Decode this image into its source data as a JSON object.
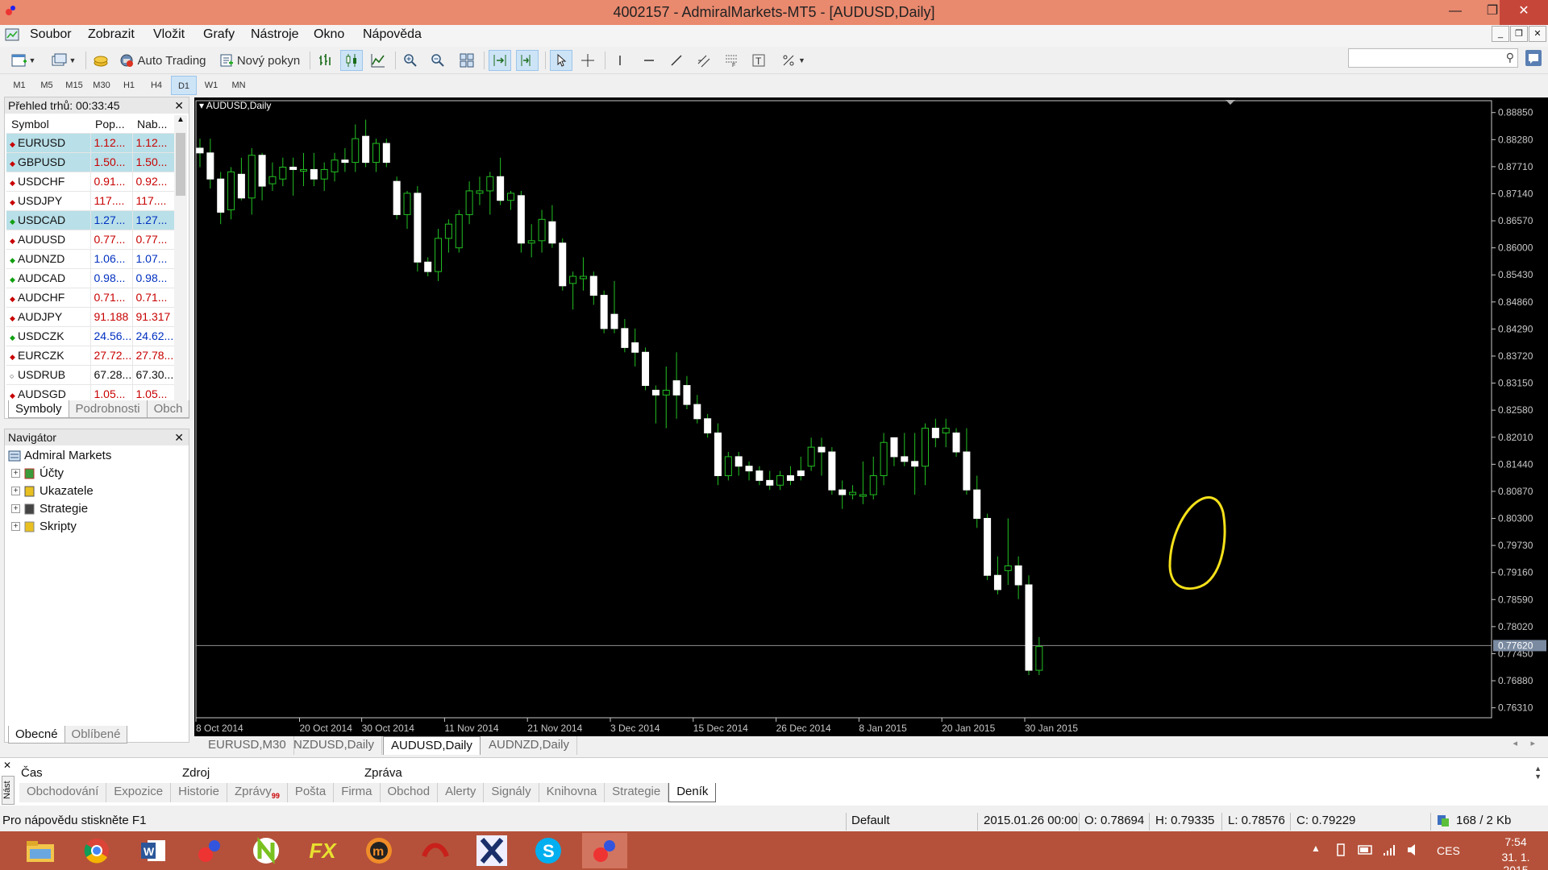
{
  "window": {
    "title": "4002157 - AdmiralMarkets-MT5 - [AUDUSD,Daily]",
    "min": "—",
    "max": "❐",
    "close": "✕"
  },
  "menu": [
    "Soubor",
    "Zobrazit",
    "Vložit",
    "Grafy",
    "Nástroje",
    "Okno",
    "Nápověda"
  ],
  "toolbar": {
    "auto_trading": "Auto Trading",
    "new_order": "Nový pokyn"
  },
  "timeframes": [
    "M1",
    "M5",
    "M15",
    "M30",
    "H1",
    "H4",
    "D1",
    "W1",
    "MN"
  ],
  "active_timeframe": "D1",
  "market_watch": {
    "title": "Přehled trhů: 00:33:45",
    "columns": [
      "Symbol",
      "Pop...",
      "Nab..."
    ],
    "rows": [
      {
        "symbol": "EURUSD",
        "bid": "1.12...",
        "ask": "1.12...",
        "dir": "down",
        "hl": true,
        "color": "red"
      },
      {
        "symbol": "GBPUSD",
        "bid": "1.50...",
        "ask": "1.50...",
        "dir": "down",
        "hl": true,
        "color": "red"
      },
      {
        "symbol": "USDCHF",
        "bid": "0.91...",
        "ask": "0.92...",
        "dir": "down",
        "hl": false,
        "color": "red"
      },
      {
        "symbol": "USDJPY",
        "bid": "117....",
        "ask": "117....",
        "dir": "down",
        "hl": false,
        "color": "red"
      },
      {
        "symbol": "USDCAD",
        "bid": "1.27...",
        "ask": "1.27...",
        "dir": "up",
        "hl": true,
        "color": "blue"
      },
      {
        "symbol": "AUDUSD",
        "bid": "0.77...",
        "ask": "0.77...",
        "dir": "down",
        "hl": false,
        "color": "red"
      },
      {
        "symbol": "AUDNZD",
        "bid": "1.06...",
        "ask": "1.07...",
        "dir": "up",
        "hl": false,
        "color": "blue"
      },
      {
        "symbol": "AUDCAD",
        "bid": "0.98...",
        "ask": "0.98...",
        "dir": "up",
        "hl": false,
        "color": "blue"
      },
      {
        "symbol": "AUDCHF",
        "bid": "0.71...",
        "ask": "0.71...",
        "dir": "down",
        "hl": false,
        "color": "red"
      },
      {
        "symbol": "AUDJPY",
        "bid": "91.188",
        "ask": "91.317",
        "dir": "down",
        "hl": false,
        "color": "red"
      },
      {
        "symbol": "USDCZK",
        "bid": "24.56...",
        "ask": "24.62...",
        "dir": "up",
        "hl": false,
        "color": "blue"
      },
      {
        "symbol": "EURCZK",
        "bid": "27.72...",
        "ask": "27.78...",
        "dir": "down",
        "hl": false,
        "color": "red"
      },
      {
        "symbol": "USDRUB",
        "bid": "67.28...",
        "ask": "67.30...",
        "dir": "none",
        "hl": false,
        "color": "black"
      },
      {
        "symbol": "AUDSGD",
        "bid": "1.05...",
        "ask": "1.05...",
        "dir": "down",
        "hl": false,
        "color": "red"
      }
    ],
    "tabs": [
      "Symboly",
      "Podrobnosti",
      "Obch"
    ]
  },
  "navigator": {
    "title": "Navigátor",
    "root": "Admiral Markets",
    "items": [
      "Účty",
      "Ukazatele",
      "Strategie",
      "Skripty"
    ],
    "tabs": [
      "Obecné",
      "Oblíbené"
    ]
  },
  "chart_data": {
    "type": "candlestick",
    "label": "AUDUSD,Daily",
    "y_ticks": [
      "0.88850",
      "0.88280",
      "0.87710",
      "0.87140",
      "0.86570",
      "0.86000",
      "0.85430",
      "0.84860",
      "0.84290",
      "0.83720",
      "0.83150",
      "0.82580",
      "0.82010",
      "0.81440",
      "0.80870",
      "0.80300",
      "0.79730",
      "0.79160",
      "0.78590",
      "0.78020",
      "0.77450",
      "0.76880",
      "0.76310"
    ],
    "y_range": [
      0.761,
      0.891
    ],
    "current_price": "0.77620",
    "current_price_value": 0.7762,
    "x_ticks": [
      "8 Oct 2014",
      "20 Oct 2014",
      "30 Oct 2014",
      "11 Nov 2014",
      "21 Nov 2014",
      "3 Dec 2014",
      "15 Dec 2014",
      "26 Dec 2014",
      "8 Jan 2015",
      "20 Jan 2015",
      "30 Jan 2015"
    ],
    "x_tick_candle_index": [
      0,
      10,
      16,
      24,
      32,
      40,
      48,
      56,
      64,
      72,
      80
    ],
    "candles": [
      [
        0.881,
        0.883,
        0.877,
        0.88
      ],
      [
        0.88,
        0.883,
        0.8725,
        0.8745
      ],
      [
        0.8745,
        0.876,
        0.865,
        0.8675
      ],
      [
        0.868,
        0.877,
        0.866,
        0.876
      ],
      [
        0.8755,
        0.879,
        0.87,
        0.8705
      ],
      [
        0.8705,
        0.881,
        0.867,
        0.8795
      ],
      [
        0.8795,
        0.88,
        0.87,
        0.873
      ],
      [
        0.8735,
        0.878,
        0.872,
        0.875
      ],
      [
        0.8745,
        0.879,
        0.873,
        0.877
      ],
      [
        0.877,
        0.879,
        0.871,
        0.8765
      ],
      [
        0.8765,
        0.88,
        0.873,
        0.8765
      ],
      [
        0.8765,
        0.88,
        0.873,
        0.8745
      ],
      [
        0.8745,
        0.878,
        0.872,
        0.8765
      ],
      [
        0.876,
        0.88,
        0.874,
        0.8785
      ],
      [
        0.8785,
        0.881,
        0.876,
        0.878
      ],
      [
        0.878,
        0.886,
        0.876,
        0.883
      ],
      [
        0.8835,
        0.887,
        0.877,
        0.878
      ],
      [
        0.878,
        0.883,
        0.876,
        0.882
      ],
      [
        0.882,
        0.883,
        0.877,
        0.878
      ],
      [
        0.874,
        0.875,
        0.866,
        0.867
      ],
      [
        0.867,
        0.872,
        0.864,
        0.8715
      ],
      [
        0.8715,
        0.873,
        0.855,
        0.857
      ],
      [
        0.857,
        0.858,
        0.854,
        0.855
      ],
      [
        0.855,
        0.864,
        0.853,
        0.862
      ],
      [
        0.862,
        0.866,
        0.859,
        0.865
      ],
      [
        0.86,
        0.868,
        0.859,
        0.867
      ],
      [
        0.867,
        0.874,
        0.865,
        0.872
      ],
      [
        0.8715,
        0.875,
        0.869,
        0.872
      ],
      [
        0.872,
        0.876,
        0.867,
        0.875
      ],
      [
        0.875,
        0.879,
        0.869,
        0.87
      ],
      [
        0.87,
        0.872,
        0.868,
        0.8715
      ],
      [
        0.871,
        0.872,
        0.859,
        0.861
      ],
      [
        0.861,
        0.865,
        0.858,
        0.8615
      ],
      [
        0.8615,
        0.868,
        0.859,
        0.866
      ],
      [
        0.8655,
        0.869,
        0.86,
        0.861
      ],
      [
        0.861,
        0.862,
        0.851,
        0.852
      ],
      [
        0.8525,
        0.855,
        0.847,
        0.854
      ],
      [
        0.8535,
        0.858,
        0.851,
        0.854
      ],
      [
        0.854,
        0.855,
        0.848,
        0.85
      ],
      [
        0.85,
        0.851,
        0.842,
        0.843
      ],
      [
        0.846,
        0.853,
        0.842,
        0.843
      ],
      [
        0.843,
        0.845,
        0.838,
        0.839
      ],
      [
        0.84,
        0.843,
        0.835,
        0.838
      ],
      [
        0.838,
        0.839,
        0.83,
        0.831
      ],
      [
        0.83,
        0.831,
        0.823,
        0.829
      ],
      [
        0.829,
        0.835,
        0.822,
        0.83
      ],
      [
        0.832,
        0.838,
        0.824,
        0.829
      ],
      [
        0.831,
        0.833,
        0.826,
        0.827
      ],
      [
        0.827,
        0.829,
        0.823,
        0.824
      ],
      [
        0.824,
        0.825,
        0.82,
        0.821
      ],
      [
        0.821,
        0.823,
        0.81,
        0.812
      ],
      [
        0.812,
        0.817,
        0.811,
        0.816
      ],
      [
        0.816,
        0.817,
        0.812,
        0.814
      ],
      [
        0.814,
        0.815,
        0.811,
        0.813
      ],
      [
        0.813,
        0.814,
        0.81,
        0.811
      ],
      [
        0.811,
        0.813,
        0.809,
        0.81
      ],
      [
        0.81,
        0.813,
        0.809,
        0.812
      ],
      [
        0.812,
        0.814,
        0.81,
        0.811
      ],
      [
        0.813,
        0.816,
        0.811,
        0.812
      ],
      [
        0.814,
        0.82,
        0.813,
        0.818
      ],
      [
        0.818,
        0.82,
        0.812,
        0.817
      ],
      [
        0.817,
        0.818,
        0.808,
        0.809
      ],
      [
        0.809,
        0.811,
        0.805,
        0.808
      ],
      [
        0.808,
        0.81,
        0.807,
        0.8085
      ],
      [
        0.808,
        0.815,
        0.806,
        0.808
      ],
      [
        0.808,
        0.816,
        0.807,
        0.812
      ],
      [
        0.812,
        0.821,
        0.81,
        0.819
      ],
      [
        0.82,
        0.82,
        0.814,
        0.816
      ],
      [
        0.816,
        0.821,
        0.814,
        0.815
      ],
      [
        0.815,
        0.821,
        0.808,
        0.814
      ],
      [
        0.814,
        0.823,
        0.81,
        0.822
      ],
      [
        0.822,
        0.824,
        0.818,
        0.82
      ],
      [
        0.821,
        0.824,
        0.818,
        0.822
      ],
      [
        0.821,
        0.822,
        0.816,
        0.817
      ],
      [
        0.817,
        0.822,
        0.808,
        0.809
      ],
      [
        0.809,
        0.812,
        0.801,
        0.803
      ],
      [
        0.803,
        0.804,
        0.79,
        0.791
      ],
      [
        0.791,
        0.795,
        0.787,
        0.788
      ],
      [
        0.792,
        0.803,
        0.789,
        0.793
      ],
      [
        0.793,
        0.795,
        0.786,
        0.789
      ],
      [
        0.789,
        0.791,
        0.77,
        0.771
      ],
      [
        0.771,
        0.778,
        0.77,
        0.776
      ]
    ]
  },
  "chart_tabs": [
    "EURUSD,M30",
    "NZDUSD,Daily",
    "AUDUSD,Daily",
    "AUDNZD,Daily"
  ],
  "active_chart_tab": "AUDUSD,Daily",
  "toolbox": {
    "headers": [
      "Čas",
      "Zdroj",
      "Zpráva"
    ],
    "side_label": "Nást",
    "tabs": [
      "Obchodování",
      "Expozice",
      "Historie",
      "Zprávy",
      "Pošta",
      "Firma",
      "Obchod",
      "Alerty",
      "Signály",
      "Knihovna",
      "Strategie",
      "Deník"
    ],
    "messages_badge": "99",
    "active_tab": "Deník"
  },
  "status": {
    "help": "Pro nápovědu stiskněte F1",
    "profile": "Default",
    "datetime": "2015.01.26 00:00",
    "open": "O: 0.78694",
    "high": "H: 0.79335",
    "low": "L: 0.78576",
    "close": "C: 0.79229",
    "traffic": "168 / 2 Kb"
  },
  "taskbar": {
    "lang": "CES",
    "time": "7:54",
    "date": "31. 1. 2015"
  },
  "colors": {
    "bull_body": "#ffffff",
    "bear_body": "#ffffff",
    "wick": "#22c022",
    "annotation": "#f5e11a",
    "titlebar": "#e9896e",
    "taskbar": "#b5513a"
  }
}
